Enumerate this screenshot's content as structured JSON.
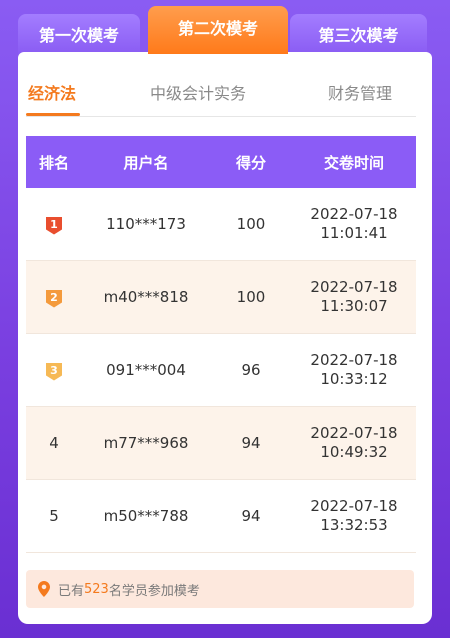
{
  "exam_tabs": [
    {
      "label": "第一次模考"
    },
    {
      "label": "第二次模考"
    },
    {
      "label": "第三次模考"
    }
  ],
  "subject_tabs": [
    {
      "label": "经济法"
    },
    {
      "label": "中级会计实务"
    },
    {
      "label": "财务管理"
    }
  ],
  "table": {
    "headers": [
      "排名",
      "用户名",
      "得分",
      "交卷时间"
    ],
    "rows": [
      {
        "rank": "1",
        "user": "110***173",
        "score": "100",
        "date": "2022-07-18",
        "time": "11:01:41"
      },
      {
        "rank": "2",
        "user": "m40***818",
        "score": "100",
        "date": "2022-07-18",
        "time": "11:30:07"
      },
      {
        "rank": "3",
        "user": "091***004",
        "score": "96",
        "date": "2022-07-18",
        "time": "10:33:12"
      },
      {
        "rank": "4",
        "user": "m77***968",
        "score": "94",
        "date": "2022-07-18",
        "time": "10:49:32"
      },
      {
        "rank": "5",
        "user": "m50***788",
        "score": "94",
        "date": "2022-07-18",
        "time": "13:32:53"
      }
    ]
  },
  "footer": {
    "prefix": "已有",
    "count": "523",
    "suffix": "名学员参加模考",
    "icon": "location-pin-icon"
  },
  "colors": {
    "accent_orange": "#f47a1e",
    "header_purple": "#8b5cf6",
    "background_purple": "#7a3fe0"
  }
}
